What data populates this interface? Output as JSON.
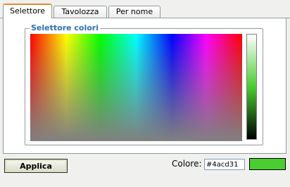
{
  "tabs": [
    {
      "label": "Selettore",
      "active": true
    },
    {
      "label": "Tavolozza",
      "active": false
    },
    {
      "label": "Per nome",
      "active": false
    }
  ],
  "picker": {
    "legend": "Selettore colori"
  },
  "footer": {
    "apply_label": "Applica",
    "color_label": "Colore:",
    "color_value": "#4acd31"
  },
  "colors": {
    "selected": "#4acd31",
    "active_tab_accent": "#e68b2c",
    "legend_text": "#2b6fb6"
  }
}
